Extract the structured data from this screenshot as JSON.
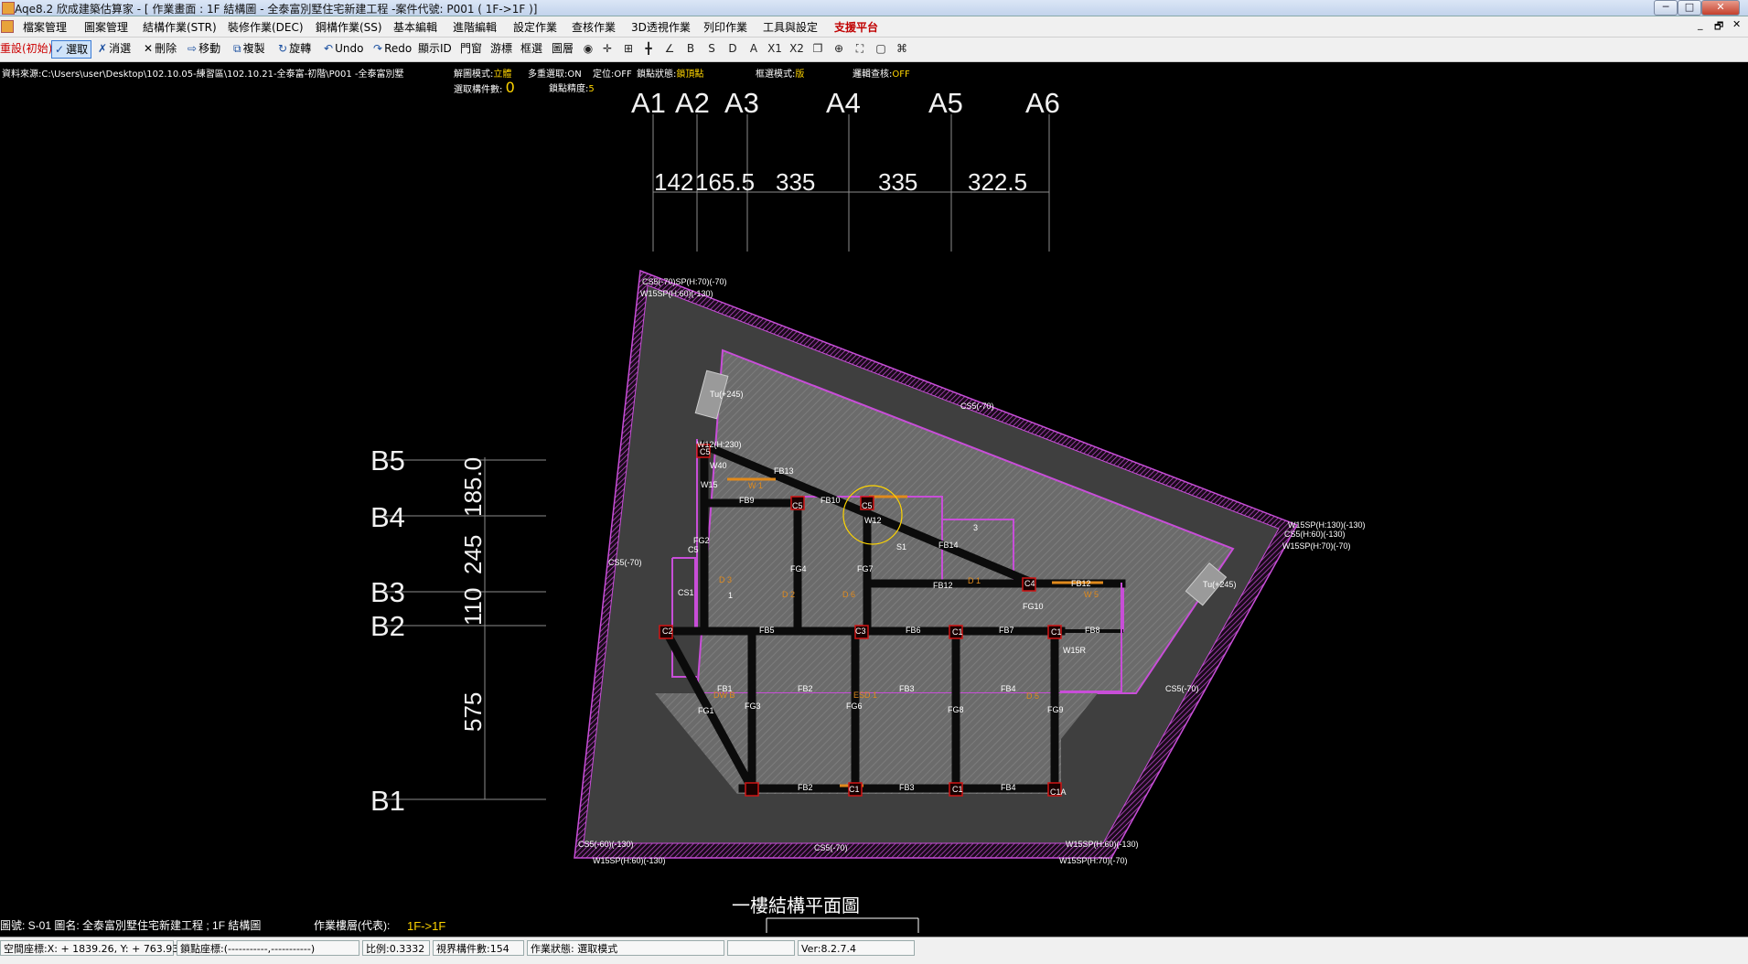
{
  "window": {
    "title": "Aqe8.2 欣成建築估算家 - [ 作業畫面 : 1F  結構圖 - 全泰富別墅住宅新建工程 -案件代號: P001 ( 1F->1F )]",
    "min": "─",
    "max": "□",
    "close": "✕"
  },
  "menu": [
    "檔案管理",
    "圖案管理",
    "結構作業(STR)",
    "裝修作業(DEC)",
    "鋼構作業(SS)",
    "基本編輯",
    "進階編輯",
    "設定作業",
    "查核作業",
    "3D透視作業",
    "列印作業",
    "工具與設定"
  ],
  "menu_support": "支援平台",
  "mdi": {
    "min": "_",
    "restore": "🗗",
    "close": "✕"
  },
  "toolbar": {
    "reset": "重設(初始)",
    "select": "選取",
    "deselect": "消選",
    "delete": "刪除",
    "move": "移動",
    "copy": "複製",
    "rotate": "旋轉",
    "undo": "Undo",
    "redo": "Redo",
    "show_id": "顯示ID",
    "window": "門窗",
    "pan": "游標",
    "box": "框選",
    "layer": "圖層",
    "letters": [
      "B",
      "S",
      "D",
      "A",
      "X1",
      "X2"
    ]
  },
  "info": {
    "source_label": "資料來源:",
    "source": "C:\\Users\\user\\Desktop\\102.10.05-練習區\\102.10.21-全泰富-初階\\P001 -全泰富別墅",
    "parse_mode_label": "解圖模式:",
    "parse_mode": "立體",
    "multi_select_label": "多重選取:",
    "multi_select": "ON",
    "locate_label": "定位:",
    "locate": "OFF",
    "snap_state_label": "鎖點狀態:",
    "snap_state": "鎖頂點",
    "box_mode_label": "框選模式:",
    "box_mode": "版",
    "logic_check_label": "邏輯查核:",
    "logic_check": "OFF",
    "selected_count_label": "選取構件數:",
    "selected_count": "0",
    "snap_precision_label": "鎖點精度:",
    "snap_precision": "5"
  },
  "grid": {
    "x_labels": [
      "A1",
      "A2",
      "A3",
      "A4",
      "A5",
      "A6"
    ],
    "x_dims": [
      "142",
      "165.5",
      "335",
      "335",
      "322.5"
    ],
    "y_labels": [
      "B5",
      "B4",
      "B3",
      "B2",
      "B1"
    ],
    "y_dims": [
      "185.0",
      "245",
      "110",
      "575"
    ]
  },
  "drawing_labels": {
    "cs5_top": "CS5(-70)",
    "cs5_left": "CS5(-70)",
    "cs5_right": "CS5(-70)",
    "cs5_bottom": "CS5(-70)",
    "sp_top": "CS5(-70)SP(H:70)(-70)",
    "sp_top2": "W15SP(H:60)(-130)",
    "sp_right": "W15SP(H:130)(-130)",
    "sp_right2": "CS5(H:60)(-130)",
    "sp_right3": "W15SP(H:70)(-70)",
    "sp_bl": "CS5(-60)(-130)",
    "sp_bl2": "W15SP(H:60)(-130)",
    "sp_br": "W15SP(H:60)(-130)",
    "sp_br2": "W15SP(H:70)(-70)",
    "box1": "Tu(+245)",
    "box2": "Tu(+245)",
    "w12": "W12(H:230)",
    "w40": "W40",
    "fb13": "FB13",
    "fb9": "FB9",
    "fb10": "FB10",
    "fb14": "FB14",
    "fb12a": "FB12",
    "fb12b": "FB12",
    "fb5": "FB5",
    "fb6": "FB6",
    "fb7": "FB7",
    "fb8": "FB8",
    "fb1": "FB1",
    "fb2": "FB2",
    "fb3": "FB3",
    "fb4": "FB4",
    "fb2b": "FB2",
    "fb3b": "FB3",
    "fb4b": "FB4",
    "fg1": "FG1",
    "fg2": "FG2",
    "fg3": "FG3",
    "fg4": "FG4",
    "fg6": "FG6",
    "fg7": "FG7",
    "fg8": "FG8",
    "fg9": "FG9",
    "fg10": "FG10",
    "c1a": "C1",
    "c1b": "C1",
    "c1c": "C1",
    "c1d": "C1",
    "c1e": "C1A",
    "c2": "C2",
    "c3": "C3",
    "c4": "C4",
    "c5a": "C5",
    "c5b": "C5",
    "c5c": "C5",
    "c5d": "C5",
    "cs1": "CS1",
    "w15": "W15",
    "w15r": "W15R",
    "s1": "S1",
    "d1": "D 1",
    "d2": "D 2",
    "d3": "D 3",
    "d5": "D 5",
    "d6": "D 6",
    "w1": "W 1",
    "w5": "W 5",
    "dwb": "DW B",
    "esd1": "ESD 1",
    "w12b": "W12",
    "n1": "1",
    "n3": "3"
  },
  "footer": {
    "drawing_no": "圖號: S-01  圖名: 全泰富別墅住宅新建工程 ; 1F  結構圖",
    "layer_label": "作業樓層(代表):",
    "layer_value": "1F->1F",
    "plan_title": "一樓結構平面圖"
  },
  "status": {
    "space_coord": "空間座標:X: + 1839.26, Y: + 763.9322",
    "snap_coord": "鎖點座標:(-----------,-----------)",
    "scale": "比例:0.3332",
    "visible": "視界構件數:154",
    "state": "作業狀態: 選取模式",
    "blank": "",
    "version": "Ver:8.2.7.4"
  },
  "colors": {
    "outline": "#c84ed8",
    "slab": "#6e6e6e",
    "beam": "#0b0b0b",
    "column": "#c01010",
    "label": "#ffffff",
    "orange": "#e08a1c",
    "highlight": "#ffd500"
  }
}
